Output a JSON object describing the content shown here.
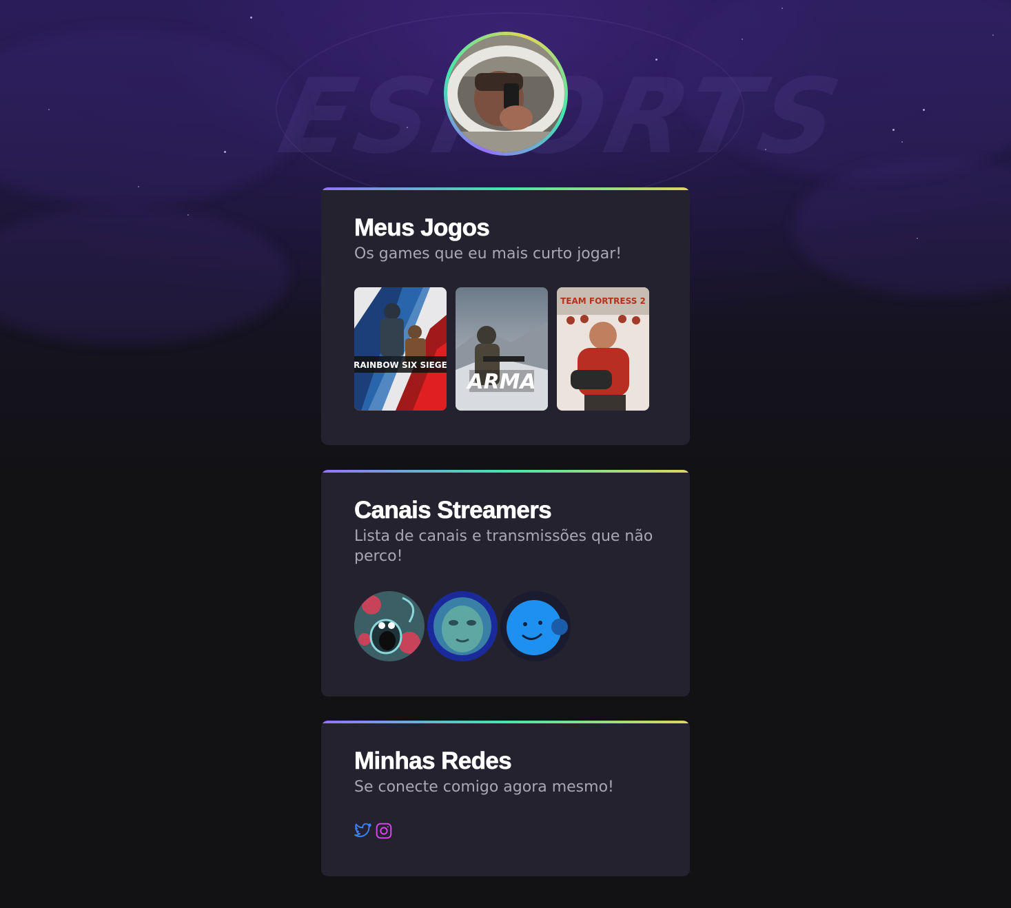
{
  "background": {
    "watermark": "ESPORTS",
    "colors": {
      "top": "#2b1d5a",
      "bottom": "#121214"
    }
  },
  "profile": {
    "avatar_icon": "profile-photo",
    "ring_colors": [
      "#9572fc",
      "#43e7ad",
      "#e1d55d"
    ]
  },
  "games_section": {
    "title": "Meus Jogos",
    "subtitle": "Os games que eu mais curto jogar!",
    "games": [
      {
        "icon": "rainbow-six-siege-cover",
        "label": "RAINBOW SIX SIEGE"
      },
      {
        "icon": "arma-3-cover",
        "label": "ARMA"
      },
      {
        "icon": "team-fortress-2-cover",
        "label": "TEAM FORTRESS 2"
      }
    ]
  },
  "streamers_section": {
    "title": "Canais Streamers",
    "subtitle": "Lista de canais e transmissões que não perco!",
    "channels": [
      {
        "icon": "streamer-avatar-monster"
      },
      {
        "icon": "streamer-avatar-face"
      },
      {
        "icon": "streamer-avatar-smiley"
      }
    ]
  },
  "social_section": {
    "title": "Minhas Redes",
    "subtitle": "Se conecte comigo agora mesmo!",
    "links": [
      {
        "icon": "twitter-icon",
        "color": "#3b82f6"
      },
      {
        "icon": "instagram-icon",
        "color": "#d946ef"
      }
    ]
  },
  "accent_gradient": [
    "#9572fc",
    "#43e7ad",
    "#e1d55d"
  ],
  "card_color": "#252230"
}
